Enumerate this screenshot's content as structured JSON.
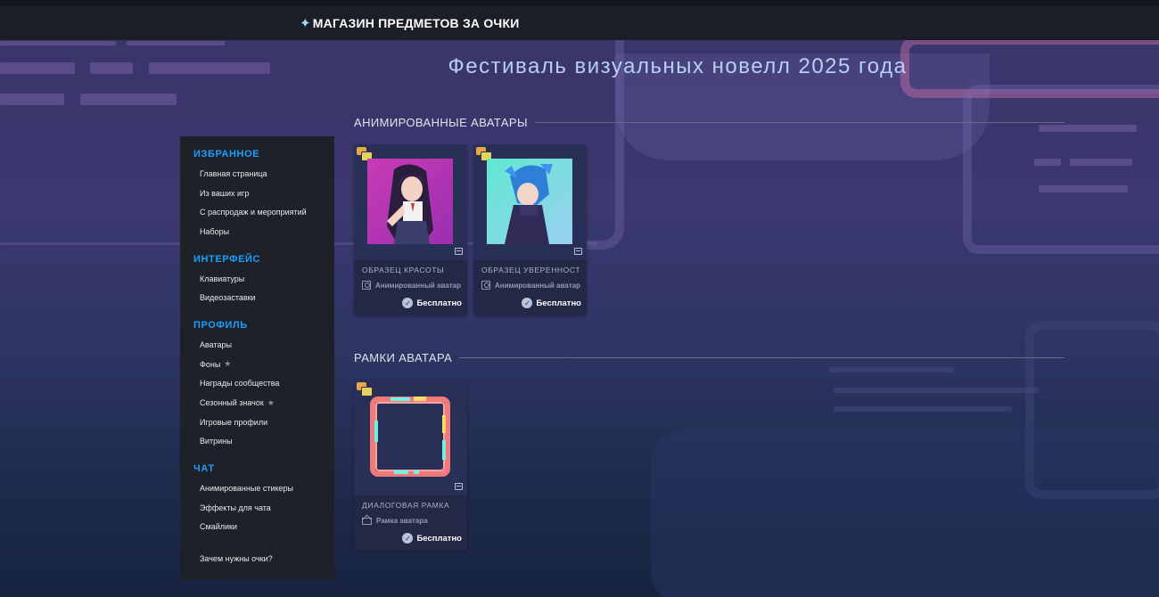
{
  "header": {
    "store_title": "МАГАЗИН ПРЕДМЕТОВ ЗА ОЧКИ"
  },
  "event_title": "Фестиваль визуальных новелл 2025 года",
  "sidebar": {
    "sections": [
      {
        "heading": "ИЗБРАННОЕ",
        "items": [
          "Главная страница",
          "Из ваших игр",
          "С распродаж и мероприятий",
          "Наборы"
        ]
      },
      {
        "heading": "ИНТЕРФЕЙС",
        "items": [
          "Клавиатуры",
          "Видеозаставки"
        ]
      },
      {
        "heading": "ПРОФИЛЬ",
        "items": [
          "Аватары",
          "Фоны",
          "Награды сообщества",
          "Сезонный значок",
          "Игровые профили",
          "Витрины"
        ]
      },
      {
        "heading": "ЧАТ",
        "items": [
          "Анимированные стикеры",
          "Эффекты для чата",
          "Смайлики"
        ]
      }
    ],
    "footer": "Зачем нужны очки?"
  },
  "sections": [
    {
      "title": "АНИМИРОВАННЫЕ АВАТАРЫ",
      "items": [
        {
          "name": "ОБРАЗЕЦ КРАСОТЫ",
          "type": "Анимированный аватар",
          "price": "Бесплатно"
        },
        {
          "name": "ОБРАЗЕЦ УВЕРЕННОСТИ",
          "type": "Анимированный аватар",
          "price": "Бесплатно"
        }
      ]
    },
    {
      "title": "РАМКИ АВАТАРА",
      "items": [
        {
          "name": "ДИАЛОГОВАЯ РАМКА",
          "type": "Рамка аватара",
          "price": "Бесплатно"
        }
      ]
    }
  ],
  "colors": {
    "accent": "#1a9fff",
    "sidebar_bg": "#1f2129",
    "topbar_bg": "#1b1e27"
  }
}
